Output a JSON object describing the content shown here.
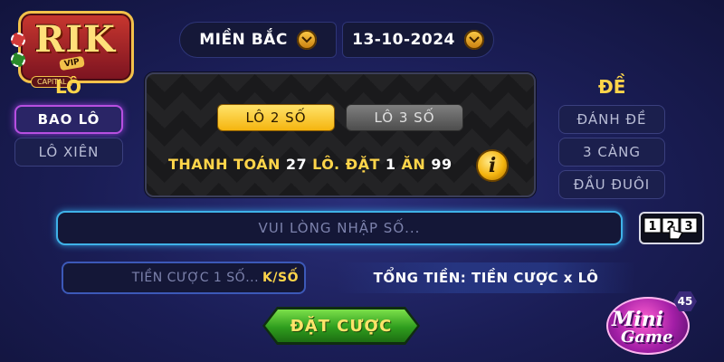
{
  "logo": {
    "wordmark": "RIK",
    "sub": "VIP",
    "caption": "CAPITAL"
  },
  "header": {
    "region": "MIỀN BẮC",
    "date": "13-10-2024"
  },
  "lo": {
    "title": "LÔ",
    "modes": [
      "BAO LÔ",
      "LÔ XIÊN"
    ],
    "selected": "BAO LÔ"
  },
  "de": {
    "title": "ĐỀ",
    "modes": [
      "ĐÁNH ĐỀ",
      "3 CÀNG",
      "ĐẦU ĐUÔI"
    ]
  },
  "panel": {
    "tabs": [
      "LÔ 2 SỐ",
      "LÔ 3 SỐ"
    ],
    "active_tab": "LÔ 2 SỐ",
    "pay_label": "THANH TOÁN",
    "pay_value": "27",
    "bet_label": "LÔ. ĐẶT",
    "bet_value": "1",
    "win_label": "ĂN",
    "win_value": "99",
    "info_symbol": "i"
  },
  "input": {
    "number_placeholder": "VUI LÒNG NHẬP SỐ...",
    "bet_placeholder": "TIỀN CƯỢC 1 SỐ...",
    "bet_unit": "K/SỐ"
  },
  "summary": {
    "total_text": "TỔNG TIỀN: TIỀN CƯỢC x LÔ"
  },
  "actions": {
    "bet_button": "ĐẶT CƯỢC"
  },
  "minigame": {
    "line1": "Mini",
    "line2": "Game",
    "count": "45"
  },
  "icons": {
    "chevron": "chevron-down-icon",
    "info": "info-icon",
    "keypad": "keypad-icon"
  },
  "colors": {
    "accent_gold": "#ffd54a",
    "active_border": "#b74fe0",
    "input_glow": "#3fb2e8",
    "bet_button_green": "#2f9d1e"
  }
}
